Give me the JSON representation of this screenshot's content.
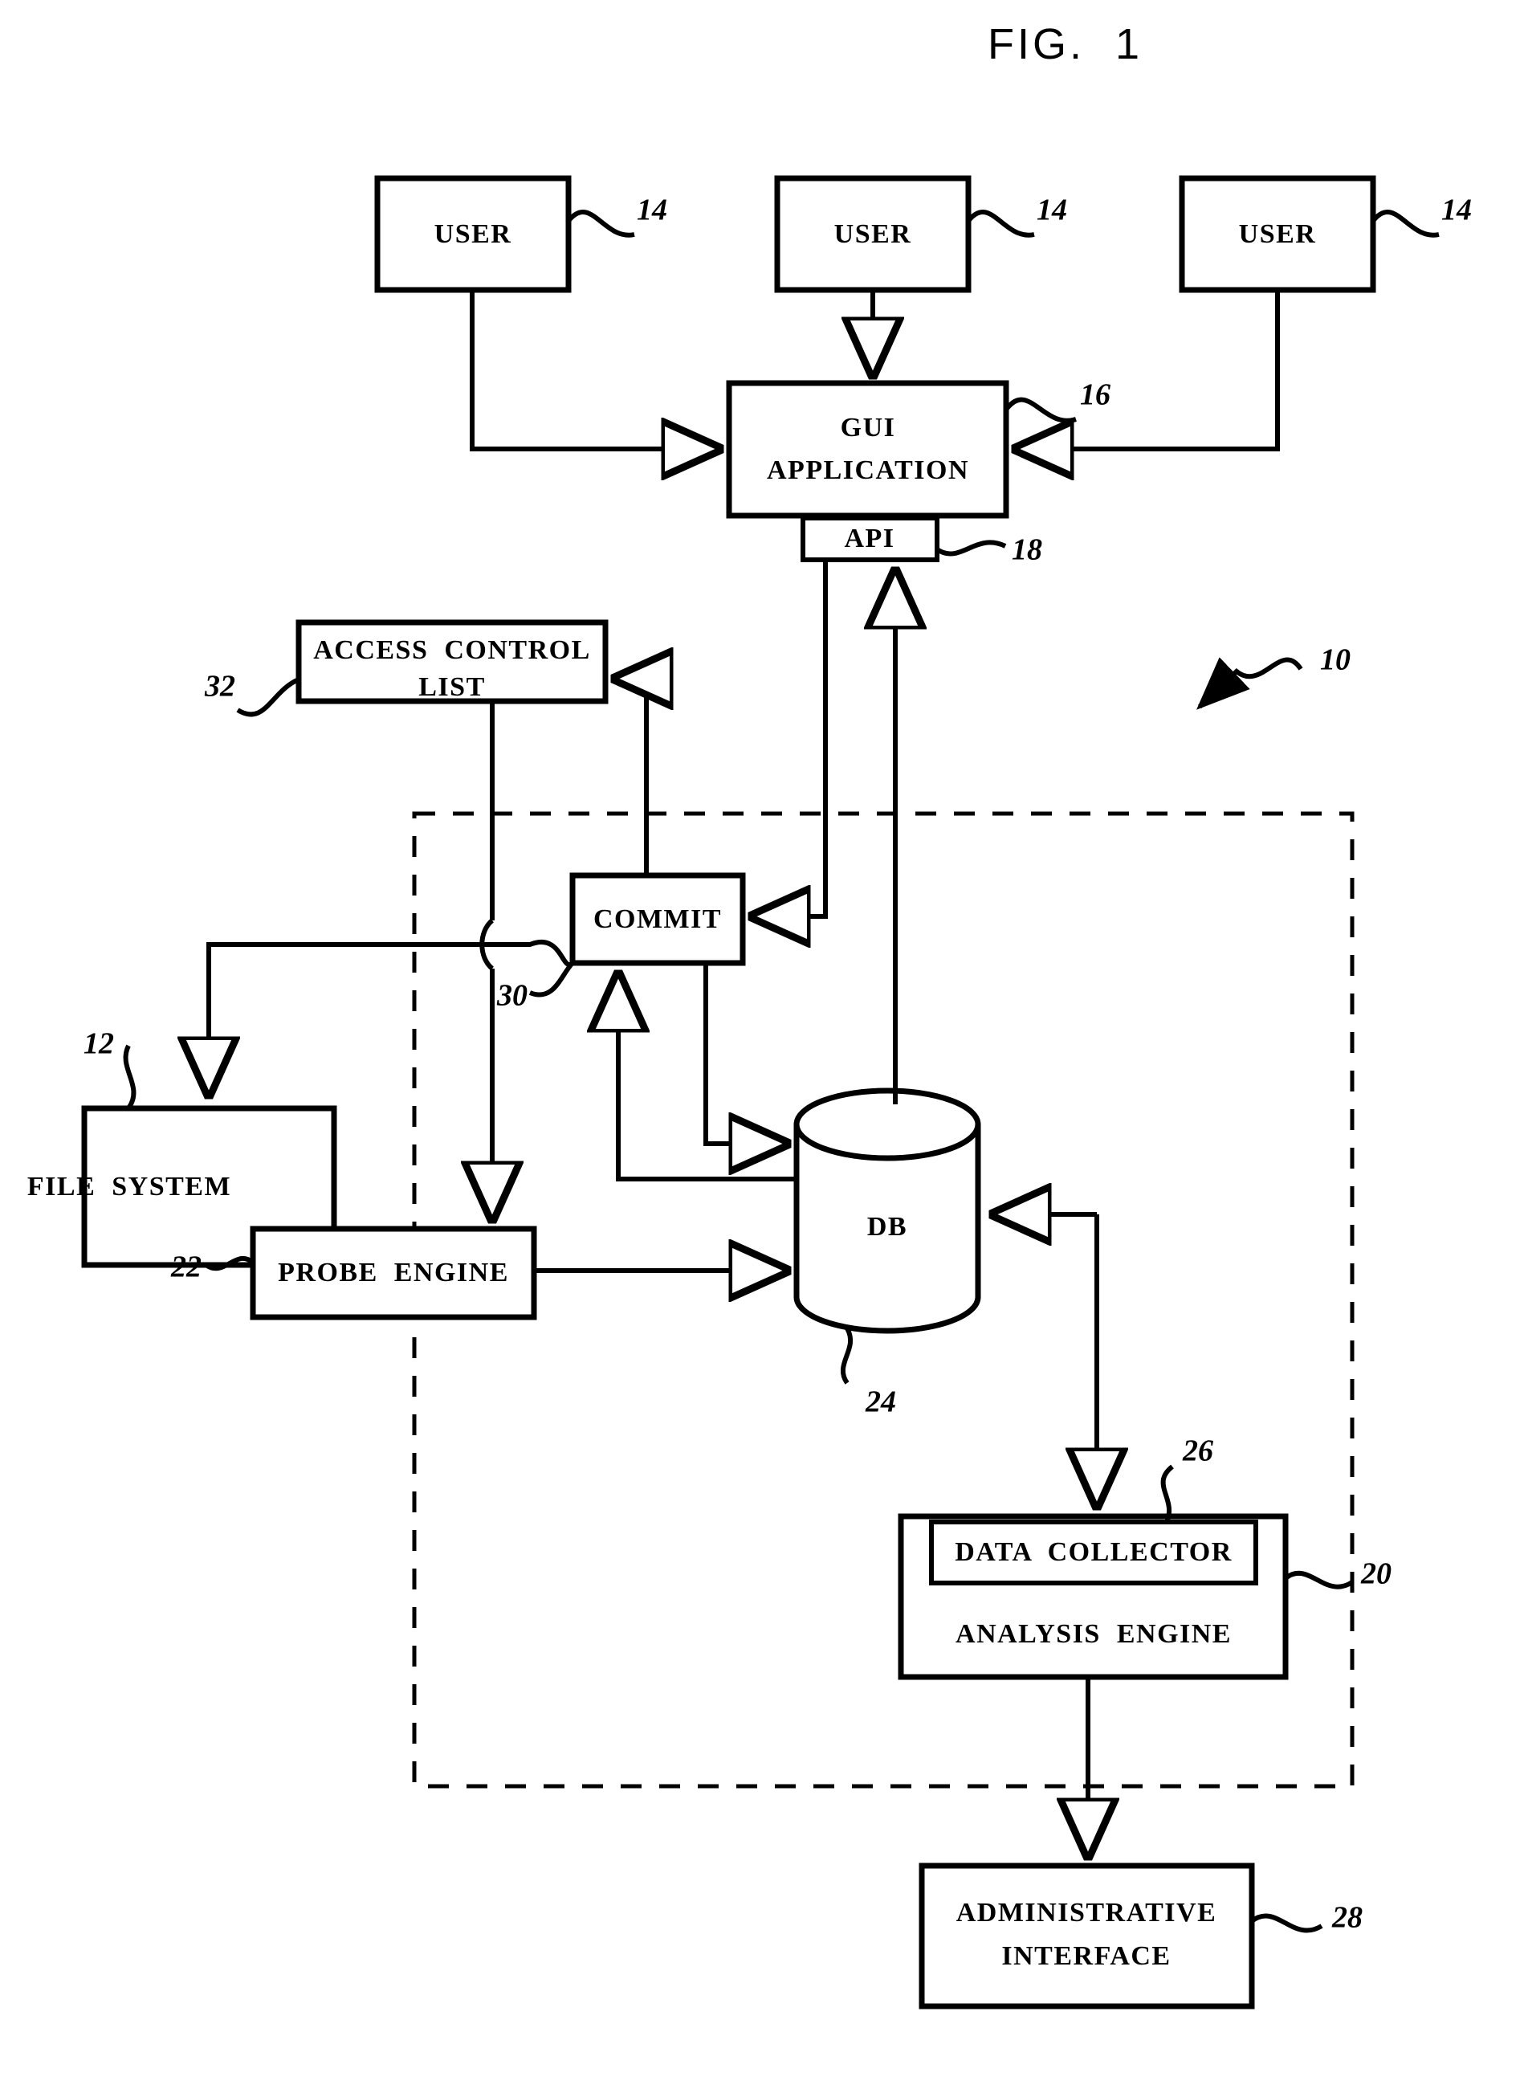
{
  "figure": {
    "title": "FIG.  1",
    "type": "patent-block-diagram"
  },
  "blocks": {
    "user_left": {
      "label": "USER",
      "ref": "14"
    },
    "user_center": {
      "label": "USER",
      "ref": "14"
    },
    "user_right": {
      "label": "USER",
      "ref": "14"
    },
    "gui_application": {
      "label_line1": "GUI",
      "label_line2": "APPLICATION",
      "ref": "16"
    },
    "api": {
      "label": "API",
      "ref": "18"
    },
    "access_control_list": {
      "label_line1": "ACCESS  CONTROL",
      "label_line2": "LIST",
      "ref": "32"
    },
    "commit": {
      "label": "COMMIT",
      "ref": "30"
    },
    "file_system": {
      "label": "FILE  SYSTEM",
      "ref": "12"
    },
    "probe_engine": {
      "label": "PROBE  ENGINE",
      "ref": "22"
    },
    "database": {
      "label": "DB",
      "ref": "24"
    },
    "data_collector": {
      "label": "DATA  COLLECTOR",
      "ref": "26"
    },
    "analysis_engine": {
      "label": "ANALYSIS  ENGINE",
      "ref": "20"
    },
    "administrative_interface": {
      "label_line1": "ADMINISTRATIVE",
      "label_line2": "INTERFACE",
      "ref": "28"
    }
  },
  "system_boundary": {
    "ref": "10",
    "style": "dashed"
  },
  "colors": {
    "stroke": "#000000",
    "background": "#ffffff"
  }
}
